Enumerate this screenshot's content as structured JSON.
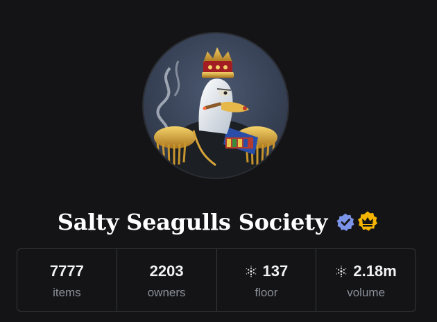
{
  "collection": {
    "name": "Salty Seagulls Society",
    "avatar_icon": "seagull-king-avatar",
    "badges": [
      {
        "name": "verified-badge-icon",
        "color": "#7b93e8"
      },
      {
        "name": "crown-badge-icon",
        "color": "#f4b400"
      }
    ]
  },
  "stats": [
    {
      "value": "7777",
      "label": "items",
      "icon": null
    },
    {
      "value": "2203",
      "label": "owners",
      "icon": null
    },
    {
      "value": "137",
      "label": "floor",
      "icon": "cardano-icon"
    },
    {
      "value": "2.18m",
      "label": "volume",
      "icon": "cardano-icon"
    }
  ],
  "colors": {
    "background": "#141416",
    "border": "#34373d",
    "text": "#ffffff",
    "muted": "#8a8f98"
  }
}
